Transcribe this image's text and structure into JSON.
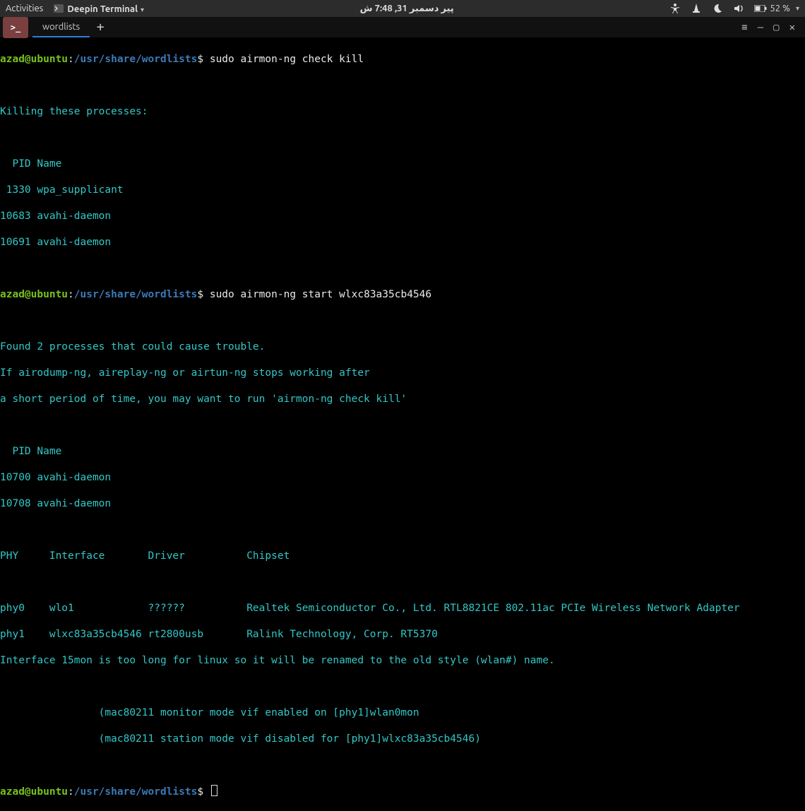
{
  "topbar": {
    "activities": "Activities",
    "app_name": "Deepin Terminal",
    "clock": "پیر دسمبر 31, 7:48 ش",
    "battery": "52 %"
  },
  "tabs": {
    "active": "wordlists",
    "plus": "+"
  },
  "winbtns": {
    "menu": "≡",
    "min": "—",
    "max": "▢",
    "close": "✕"
  },
  "prompt": {
    "userhost": "azad@ubuntu",
    "sep": ":",
    "cwd": "/usr/share/wordlists",
    "end": "$"
  },
  "cmd1": "sudo airmon-ng check kill",
  "out1": {
    "l1": "Killing these processes:",
    "l2": "  PID Name",
    "l3": " 1330 wpa_supplicant",
    "l4": "10683 avahi-daemon",
    "l5": "10691 avahi-daemon"
  },
  "cmd2": "sudo airmon-ng start wlxc83a35cb4546",
  "out2": {
    "l1": "Found 2 processes that could cause trouble.",
    "l2": "If airodump-ng, aireplay-ng or airtun-ng stops working after",
    "l3": "a short period of time, you may want to run 'airmon-ng check kill'",
    "l4": "  PID Name",
    "l5": "10700 avahi-daemon",
    "l6": "10708 avahi-daemon",
    "l7": "PHY     Interface       Driver          Chipset",
    "l8": "phy0    wlo1            ??????          Realtek Semiconductor Co., Ltd. RTL8821CE 802.11ac PCIe Wireless Network Adapter",
    "l9": "phy1    wlxc83a35cb4546 rt2800usb       Ralink Technology, Corp. RT5370",
    "l10": "Interface 15mon is too long for linux so it will be renamed to the old style (wlan#) name.",
    "l11": "                (mac80211 monitor mode vif enabled on [phy1]wlan0mon",
    "l12": "                (mac80211 station mode vif disabled for [phy1]wlxc83a35cb4546)"
  }
}
